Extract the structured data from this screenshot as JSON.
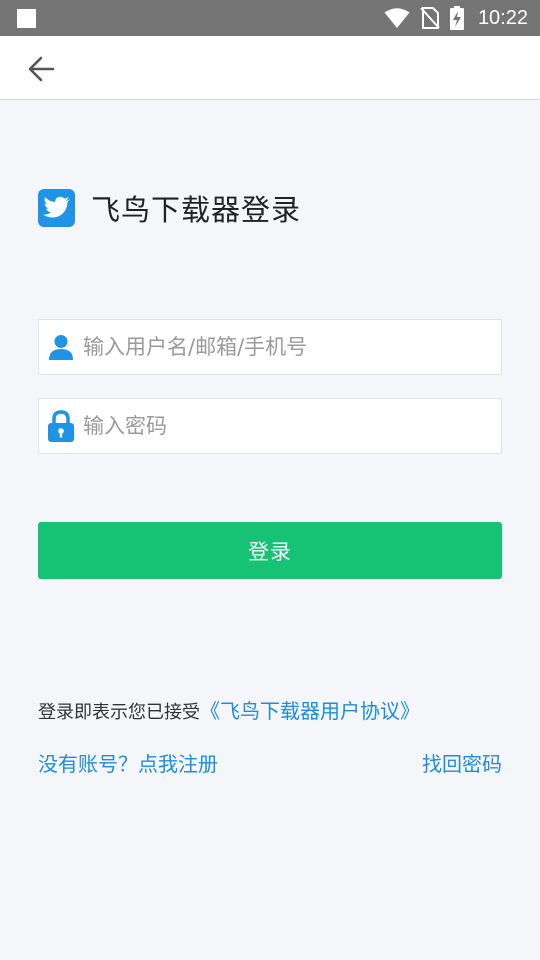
{
  "status_bar": {
    "time": "10:22",
    "icons": [
      "notification-square-icon",
      "wifi-icon",
      "no-sim-icon",
      "battery-charging-icon"
    ]
  },
  "toolbar": {
    "back_icon": "arrow-left-icon"
  },
  "brand": {
    "logo_icon": "bird-logo-icon",
    "title": "飞鸟下载器登录"
  },
  "form": {
    "username": {
      "icon": "user-icon",
      "placeholder": "输入用户名/邮箱/手机号",
      "value": ""
    },
    "password": {
      "icon": "lock-icon",
      "placeholder": "输入密码",
      "value": ""
    },
    "login_label": "登录"
  },
  "footer": {
    "agreement_prefix": "登录即表示您已接受",
    "agreement_link": "《飞鸟下载器用户协议》",
    "register_link": "没有账号？点我注册",
    "forgot_link": "找回密码"
  },
  "colors": {
    "status_bar": "#757575",
    "background": "#f4f6f9",
    "accent_blue": "#1e8ce0",
    "login_green": "#16c273"
  }
}
